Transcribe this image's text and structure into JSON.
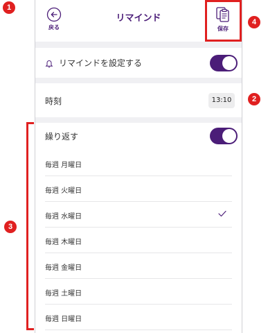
{
  "header": {
    "title": "リマインド",
    "back_label": "戻る",
    "save_label": "保存"
  },
  "reminder": {
    "label": "リマインドを設定する",
    "enabled": true
  },
  "time": {
    "label": "時刻",
    "value": "13:10"
  },
  "repeat": {
    "label": "繰り返す",
    "enabled": true,
    "days": [
      {
        "label": "毎週 月曜日",
        "checked": false
      },
      {
        "label": "毎週 火曜日",
        "checked": false
      },
      {
        "label": "毎週 水曜日",
        "checked": true
      },
      {
        "label": "毎週 木曜日",
        "checked": false
      },
      {
        "label": "毎週 金曜日",
        "checked": false
      },
      {
        "label": "毎週 土曜日",
        "checked": false
      },
      {
        "label": "毎週 日曜日",
        "checked": false
      }
    ]
  },
  "annotations": [
    "1",
    "2",
    "3",
    "4"
  ],
  "colors": {
    "accent": "#4b1d78",
    "annotation": "#e02020",
    "background": "#f0f0f3"
  }
}
